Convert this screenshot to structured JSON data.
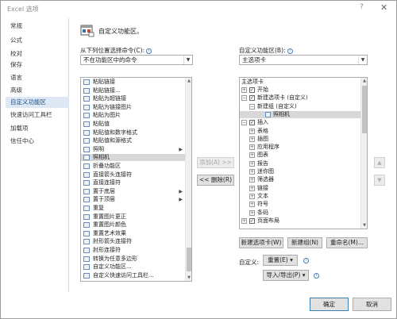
{
  "window": {
    "title": "Excel 选项",
    "help_glyph": "?",
    "close_glyph": "✕"
  },
  "nav": {
    "items": [
      {
        "label": "常规"
      },
      {
        "label": "公式"
      },
      {
        "label": "校对"
      },
      {
        "label": "保存"
      },
      {
        "label": "语言"
      },
      {
        "label": "高级"
      },
      {
        "label": "自定义功能区",
        "active": true
      },
      {
        "label": "快速访问工具栏"
      },
      {
        "label": "加载项"
      },
      {
        "label": "信任中心"
      }
    ]
  },
  "header": {
    "title": "自定义功能区。"
  },
  "left": {
    "choose_label": "从下列位置选择命令(C):",
    "choose_value": "不在功能区中的命令",
    "commands": [
      {
        "label": "粘贴链接"
      },
      {
        "label": "粘贴链接..."
      },
      {
        "label": "粘贴为超链接"
      },
      {
        "label": "粘贴为链接图片"
      },
      {
        "label": "粘贴为图片"
      },
      {
        "label": "粘贴值"
      },
      {
        "label": "粘贴值和数字格式"
      },
      {
        "label": "粘贴值和源格式"
      },
      {
        "label": "照明",
        "submenu": true
      },
      {
        "label": "照相机",
        "selected": true
      },
      {
        "label": "折叠功能区"
      },
      {
        "label": "直接箭头连接符"
      },
      {
        "label": "直接连接符"
      },
      {
        "label": "置于底层",
        "submenu": true
      },
      {
        "label": "置于顶层",
        "submenu": true
      },
      {
        "label": "重复"
      },
      {
        "label": "重置图片更正"
      },
      {
        "label": "重置图片颜色"
      },
      {
        "label": "重置艺术效果"
      },
      {
        "label": "肘形箭头连接符"
      },
      {
        "label": "肘形连接符"
      },
      {
        "label": "转换为任意多边形"
      },
      {
        "label": "自定义功能区..."
      },
      {
        "label": "自定义快速访问工具栏..."
      }
    ]
  },
  "middle": {
    "add_label": "添加(A) >>",
    "remove_label": "<< 删除(R)"
  },
  "right": {
    "customize_label": "自定义功能区(B):",
    "customize_value": "主选项卡",
    "tree_header": "主选项卡",
    "tree": [
      {
        "label": "开始",
        "level": 0,
        "exp": "⊞",
        "checked": true
      },
      {
        "label": "新建选项卡 (自定义)",
        "level": 0,
        "exp": "⊟",
        "checked": true
      },
      {
        "label": "新建组 (自定义)",
        "level": 1,
        "exp": "⊟"
      },
      {
        "label": "照相机",
        "level": 2,
        "icon": true,
        "selected": true
      },
      {
        "label": "插入",
        "level": 0,
        "exp": "⊟",
        "checked": true
      },
      {
        "label": "表格",
        "level": 1,
        "exp": "⊞"
      },
      {
        "label": "插图",
        "level": 1,
        "exp": "⊞"
      },
      {
        "label": "应用程序",
        "level": 1,
        "exp": "⊞"
      },
      {
        "label": "图表",
        "level": 1,
        "exp": "⊞"
      },
      {
        "label": "报告",
        "level": 1,
        "exp": "⊞"
      },
      {
        "label": "迷你图",
        "level": 1,
        "exp": "⊞"
      },
      {
        "label": "筛选器",
        "level": 1,
        "exp": "⊞"
      },
      {
        "label": "链接",
        "level": 1,
        "exp": "⊞"
      },
      {
        "label": "文本",
        "level": 1,
        "exp": "⊞"
      },
      {
        "label": "符号",
        "level": 1,
        "exp": "⊞"
      },
      {
        "label": "条码",
        "level": 1,
        "exp": "⊞"
      },
      {
        "label": "页面布局",
        "level": 0,
        "exp": "⊞",
        "checked": true
      }
    ],
    "new_tab_label": "新建选项卡(W)",
    "new_group_label": "新建组(N)",
    "rename_label": "重命名(M)...",
    "customizations_label": "自定义:",
    "reset_label": "重置(E) ▾",
    "import_export_label": "导入/导出(P) ▾"
  },
  "footer": {
    "ok_label": "确定",
    "cancel_label": "取消"
  }
}
